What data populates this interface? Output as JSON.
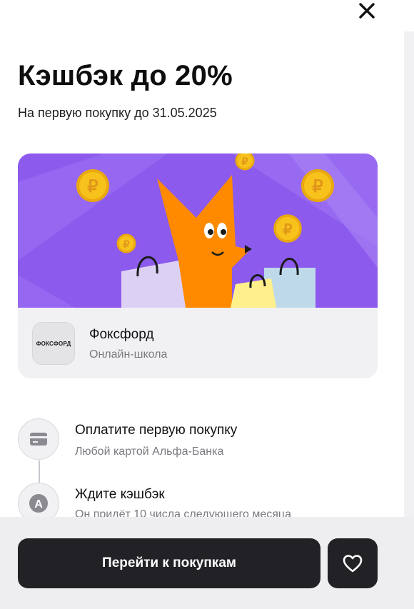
{
  "offer": {
    "title": "Кэшбэк до 20%",
    "subtitle": "На первую покупку до 31.05.2025"
  },
  "merchant": {
    "name": "Фоксфорд",
    "description": "Онлайн-школа",
    "logo_text": "ФОКСФОРД"
  },
  "steps": [
    {
      "title": "Оплатите первую покупку",
      "description": "Любой картой Альфа-Банка",
      "icon": "card-icon"
    },
    {
      "title": "Ждите кэшбэк",
      "description": "Он придёт 10 числа следующего месяца",
      "icon": "alfa-logo-icon",
      "icon_letter": "А"
    }
  ],
  "footer": {
    "primary_button": "Перейти к покупкам",
    "favorite_icon": "heart-icon"
  },
  "icons": {
    "close": "close-icon",
    "coin_symbol": "₽"
  },
  "colors": {
    "banner_purple": "#8c5aec",
    "fox_orange": "#ff8a00",
    "coin_gold": "#f7c21b",
    "button_dark": "#222226"
  }
}
